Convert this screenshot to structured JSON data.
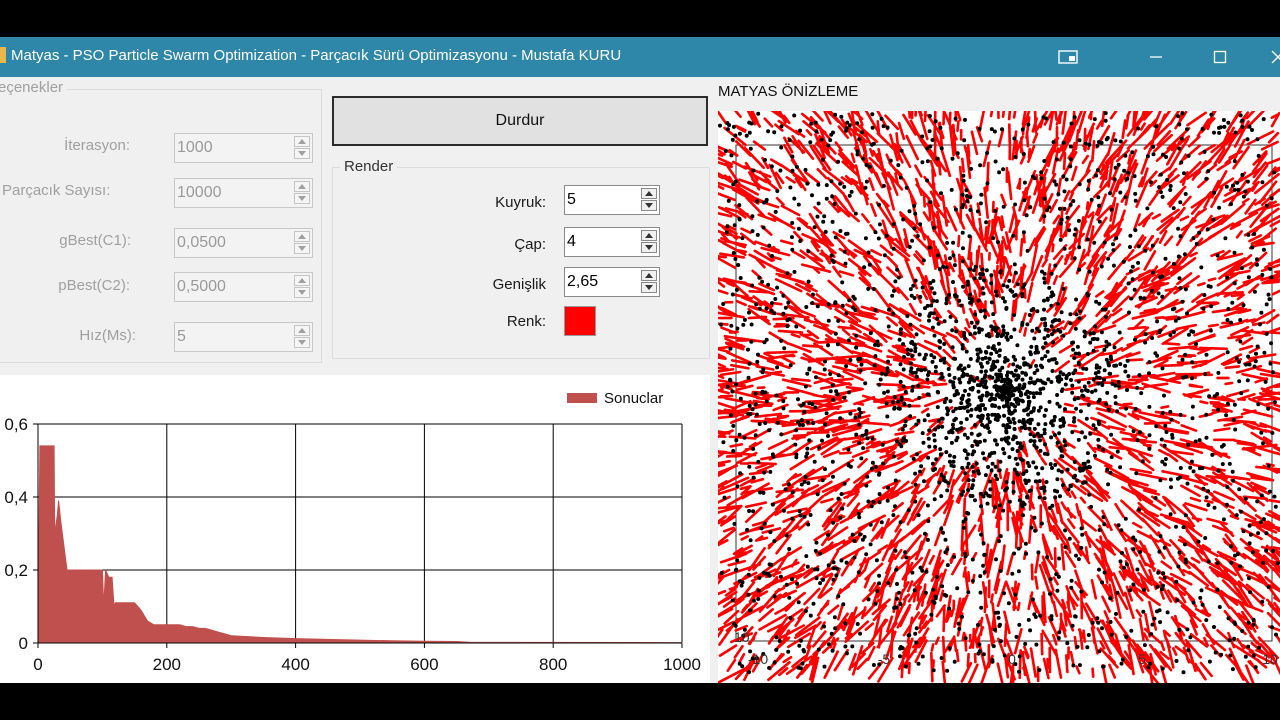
{
  "window": {
    "title": "Matyas - PSO Particle Swarm Optimization - Parçacık Sürü Optimizasyonu - Mustafa KURU",
    "accent": "#2e86a8"
  },
  "options": {
    "group_title": "eçenekler",
    "fields": [
      {
        "label": "İterasyon:",
        "value": "1000"
      },
      {
        "label": "Parçacık Sayısı:",
        "value": "10000"
      },
      {
        "label": "gBest(C1):",
        "value": "0,0500"
      },
      {
        "label": "pBest(C2):",
        "value": "0,5000"
      },
      {
        "label": "Hız(Ms):",
        "value": "5"
      }
    ]
  },
  "stop_button": {
    "label": "Durdur"
  },
  "render": {
    "group_title": "Render",
    "kuyruk": {
      "label": "Kuyruk:",
      "value": "5"
    },
    "cap": {
      "label": "Çap:",
      "value": "4"
    },
    "genislik": {
      "label": "Genişlik",
      "value": "2,65"
    },
    "renk": {
      "label": "Renk:",
      "color": "#ff0000"
    }
  },
  "chart_data": {
    "type": "area",
    "title": "",
    "series": [
      {
        "name": "Sonuclar",
        "color": "#c0504d"
      }
    ],
    "x": [
      0,
      3,
      4,
      25,
      26,
      30,
      32,
      35,
      45,
      55,
      60,
      75,
      90,
      100,
      102,
      105,
      110,
      115,
      118,
      120,
      130,
      140,
      150,
      160,
      170,
      180,
      200,
      210,
      220,
      230,
      240,
      250,
      260,
      270,
      280,
      290,
      300,
      350,
      400,
      450,
      500,
      550,
      600,
      650,
      670,
      1000
    ],
    "values": [
      0.05,
      0.54,
      0.54,
      0.54,
      0.3,
      0.35,
      0.39,
      0.34,
      0.2,
      0.2,
      0.2,
      0.2,
      0.2,
      0.2,
      0.1,
      0.2,
      0.18,
      0.18,
      0.1,
      0.11,
      0.11,
      0.11,
      0.11,
      0.09,
      0.06,
      0.05,
      0.05,
      0.05,
      0.05,
      0.045,
      0.045,
      0.04,
      0.04,
      0.035,
      0.03,
      0.025,
      0.02,
      0.015,
      0.012,
      0.01,
      0.008,
      0.006,
      0.005,
      0.004,
      0.002,
      0.001
    ],
    "xlim": [
      0,
      1000
    ],
    "ylim": [
      0,
      0.6
    ],
    "x_ticks": [
      "0",
      "200",
      "400",
      "600",
      "800",
      "1000"
    ],
    "y_ticks": [
      "0",
      "0,2",
      "0,4",
      "0,6"
    ],
    "grid": true,
    "legend": "top-right"
  },
  "preview": {
    "title": "MATYAS ÖNİZLEME",
    "x_ticks": [
      "-10",
      "-5",
      "0",
      "5",
      "10"
    ],
    "y_tick_bottom": "10",
    "tail_color": "#ff0000",
    "particle_color": "#000000"
  },
  "icons": {
    "window_extra": "screen-icon",
    "minimize": "minimize-icon",
    "maximize": "maximize-icon",
    "close": "close-icon"
  }
}
